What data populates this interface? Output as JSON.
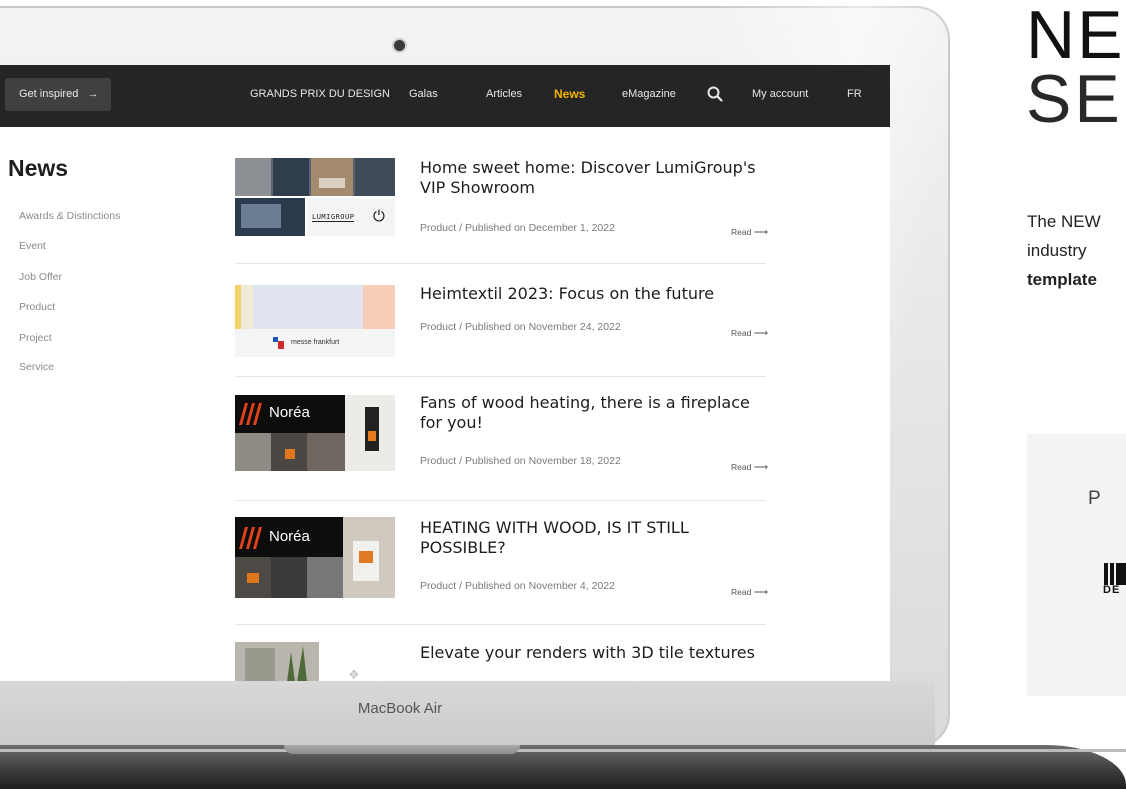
{
  "nav": {
    "inspired_label": "Get inspired",
    "inspired_arrow": "→",
    "items": [
      "GRANDS PRIX DU DESIGN",
      "Galas",
      "Articles",
      "News",
      "eMagazine"
    ],
    "account": "My account",
    "lang": "FR"
  },
  "sidebar": {
    "title": "News",
    "items": [
      "Awards & Distinctions",
      "Event",
      "Job Offer",
      "Product",
      "Project",
      "Service"
    ]
  },
  "articles": [
    {
      "title": "Home sweet home: Discover LumiGroup's VIP Showroom",
      "meta": "Product / Published on December 1, 2022",
      "read": "Read",
      "brand": "LUMIGROUP"
    },
    {
      "title": "Heimtextil 2023: Focus on the future",
      "meta": "Product / Published on November 24, 2022",
      "read": "Read",
      "brand": "messe frankfurt"
    },
    {
      "title": "Fans of wood heating, there is a fireplace for you!",
      "meta": "Product / Published on November 18, 2022",
      "read": "Read",
      "brand": "Noréa"
    },
    {
      "title": "HEATING WITH WOOD, IS IT STILL POSSIBLE?",
      "meta": "Product / Published on November 4, 2022",
      "read": "Read",
      "brand": "Noréa"
    },
    {
      "title": "Elevate your renders with 3D tile textures",
      "meta": "",
      "read": "",
      "brand": ""
    }
  ],
  "device_label": "MacBook Air",
  "right_panel": {
    "heading_line1": "NE",
    "heading_line2": "SE(",
    "text_line1": "The NEW",
    "text_line2": "industry",
    "text_line3": "template",
    "box_letter": "P",
    "logo_text": "DE"
  },
  "colors": {
    "nav_bg": "#252525",
    "accent": "#f3b200"
  }
}
